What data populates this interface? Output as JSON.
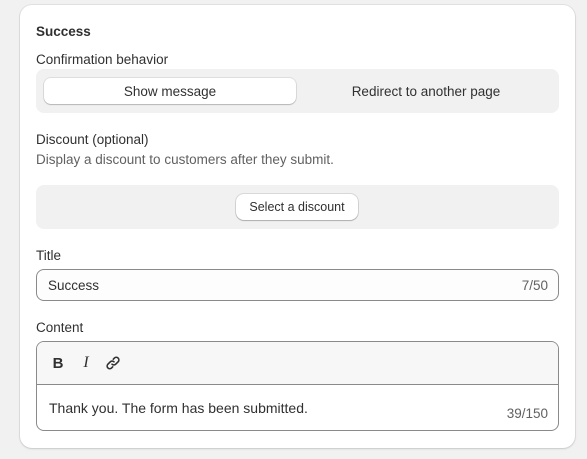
{
  "section": {
    "title": "Success"
  },
  "confirmation": {
    "label": "Confirmation behavior",
    "options": [
      {
        "label": "Show message",
        "selected": true
      },
      {
        "label": "Redirect to another page",
        "selected": false
      }
    ]
  },
  "discount": {
    "label": "Discount (optional)",
    "help": "Display a discount to customers after they submit.",
    "button_label": "Select a discount"
  },
  "title_field": {
    "label": "Title",
    "value": "Success",
    "counter": "7/50"
  },
  "content_field": {
    "label": "Content",
    "toolbar": {
      "bold": "B",
      "italic": "I",
      "link_icon": "link-icon"
    },
    "value": "Thank you. The form has been submitted.",
    "counter": "39/150"
  }
}
